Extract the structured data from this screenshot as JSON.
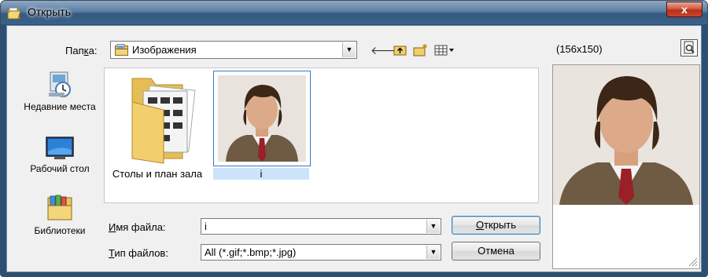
{
  "window": {
    "title": "Открыть",
    "close_symbol": "x",
    "title_icon": "folder-open-icon"
  },
  "toolbar": {
    "lookin_label_pre": "Пап",
    "lookin_label_accel": "к",
    "lookin_label_post": "а:",
    "current_folder": "Изображения",
    "back_icon": "back-arrow-icon",
    "up_icon": "up-folder-icon",
    "new_folder_icon": "new-folder-icon",
    "views_icon": "view-menu-icon"
  },
  "places": [
    {
      "label": "Недавние места",
      "icon": "recent-places-icon"
    },
    {
      "label": "Рабочий стол",
      "icon": "desktop-icon"
    },
    {
      "label": "Библиотеки",
      "icon": "libraries-icon"
    }
  ],
  "files": [
    {
      "name": "Столы и план зала",
      "type": "folder",
      "selected": false
    },
    {
      "name": "i",
      "type": "image",
      "selected": true
    }
  ],
  "form": {
    "filename_label_accel": "И",
    "filename_label_rest": "мя файла:",
    "filename_value": "i",
    "filetype_label_accel": "Т",
    "filetype_label_rest": "ип файлов:",
    "filetype_value": "All (*.gif;*.bmp;*.jpg)"
  },
  "buttons": {
    "open_accel": "О",
    "open_rest": "ткрыть",
    "cancel": "Отмена"
  },
  "preview": {
    "size_label": "(156x150)",
    "toggle_icon": "preview-toggle-icon"
  }
}
